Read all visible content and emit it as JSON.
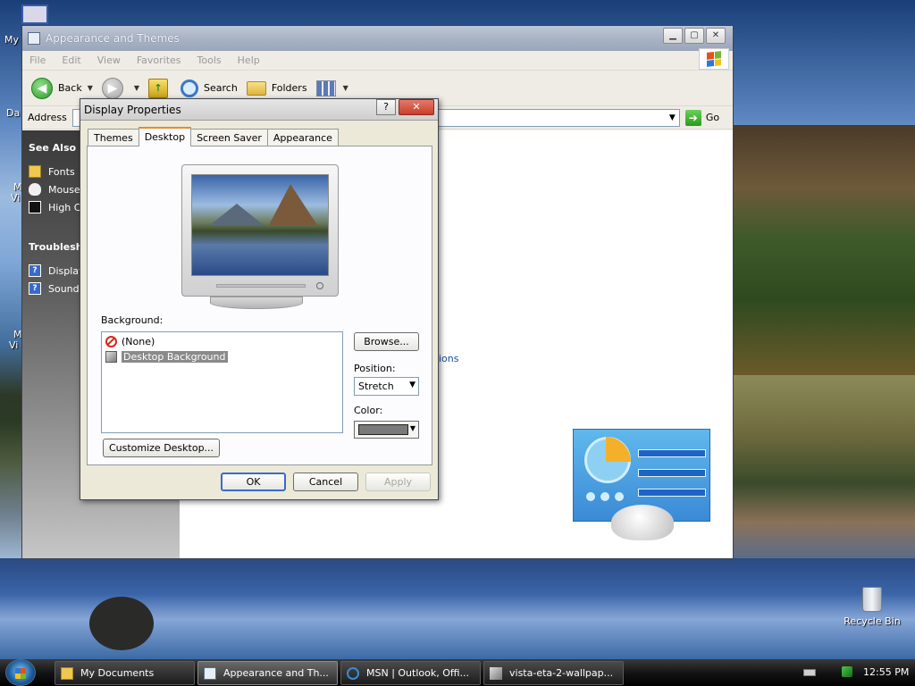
{
  "desktop": {
    "icons_left": [
      "My",
      "Da",
      "M",
      "Vi",
      "M",
      "Vi"
    ],
    "recycle_bin_label": "Recycle Bin"
  },
  "explorer": {
    "title": "Appearance and Themes",
    "menu": [
      "File",
      "Edit",
      "View",
      "Favorites",
      "Tools",
      "Help"
    ],
    "toolbar": {
      "back_label": "Back",
      "search_label": "Search",
      "folders_label": "Folders"
    },
    "address_label": "Address",
    "go_label": "Go",
    "see_also": {
      "heading": "See Also",
      "items": [
        {
          "label": "Fonts",
          "icon": "folder-icon"
        },
        {
          "label": "Mouse",
          "icon": "mouse-icon"
        },
        {
          "label": "High C",
          "icon": "high-contrast-icon"
        }
      ]
    },
    "troubleshooters": {
      "heading": "Troublesho",
      "items": [
        {
          "label": "Display",
          "icon": "help-icon"
        },
        {
          "label": "Sound",
          "icon": "help-icon"
        }
      ]
    },
    "link_fragment": "ions"
  },
  "dialog": {
    "title": "Display Properties",
    "help_glyph": "?",
    "close_glyph": "✕",
    "tabs": [
      "Themes",
      "Desktop",
      "Screen Saver",
      "Appearance"
    ],
    "active_tab": "Desktop",
    "background_label": "Background:",
    "background_items": [
      "(None)",
      "Desktop Background"
    ],
    "selected_background": "Desktop Background",
    "browse_label": "Browse...",
    "position_label": "Position:",
    "position_value": "Stretch",
    "color_label": "Color:",
    "color_value": "#7a7a7a",
    "customize_label": "Customize Desktop...",
    "ok_label": "OK",
    "cancel_label": "Cancel",
    "apply_label": "Apply"
  },
  "taskbar": {
    "buttons": [
      {
        "label": "My Documents",
        "icon": "folder-icon"
      },
      {
        "label": "Appearance and Th...",
        "icon": "control-panel-icon",
        "active": true
      },
      {
        "label": "MSN | Outlook, Offi...",
        "icon": "ie-icon"
      },
      {
        "label": "vista-eta-2-wallpap...",
        "icon": "image-viewer-icon"
      }
    ],
    "clock": "12:55 PM"
  }
}
